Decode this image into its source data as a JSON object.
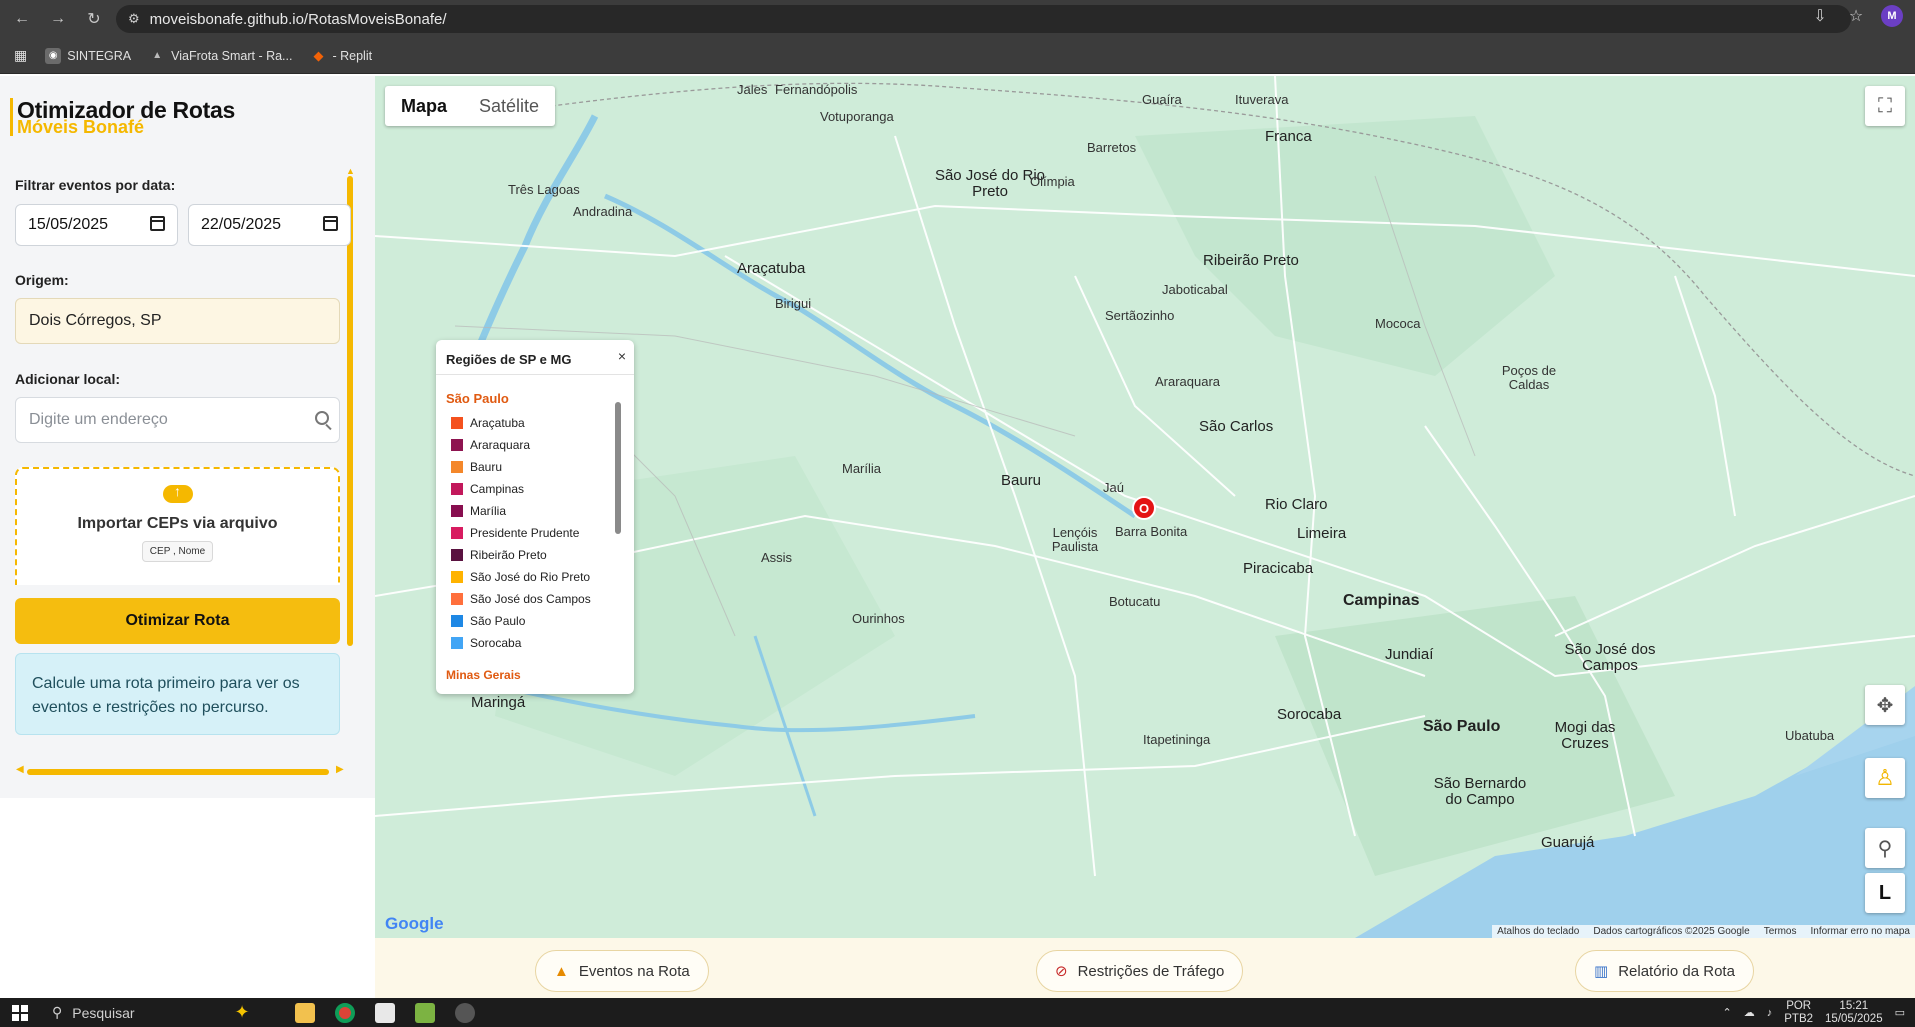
{
  "browser": {
    "url": "moveisbonafe.github.io/RotasMoveisBonafe/",
    "profile_initial": "M",
    "bookmarks": [
      {
        "label": "SINTEGRA",
        "icon": "globe-icon",
        "color": "#6b6b6b"
      },
      {
        "label": "ViaFrota Smart - Ra...",
        "icon": "car-icon",
        "color": "#555"
      },
      {
        "label": "- Replit",
        "icon": "replit-icon",
        "color": "#f26207"
      }
    ]
  },
  "sidebar": {
    "title": "Otimizador de Rotas",
    "subtitle": "Móveis Bonafé",
    "date_filter_label": "Filtrar eventos por data:",
    "date_start": "15/05/2025",
    "date_end": "22/05/2025",
    "origin_label": "Origem:",
    "origin_value": "Dois Córregos, SP",
    "add_label": "Adicionar local:",
    "add_placeholder": "Digite um endereço",
    "import_title": "Importar CEPs via arquivo",
    "import_format": "CEP , Nome",
    "optimize_button": "Otimizar Rota",
    "info_text": "Calcule uma rota primeiro para ver os eventos e restrições no percurso.",
    "accent_color": "#f5b800"
  },
  "map": {
    "type_map": "Mapa",
    "type_satellite": "Satélite",
    "marker_label": "O",
    "attribution": [
      "Atalhos do teclado",
      "Dados cartográficos ©2025 Google",
      "Termos",
      "Informar erro no mapa"
    ],
    "google": "Google",
    "pegman_label": "",
    "l_button": "L",
    "cities": [
      {
        "name": "Jales",
        "cls": ""
      },
      {
        "name": "Fernandópolis",
        "cls": ""
      },
      {
        "name": "Votuporanga",
        "cls": ""
      },
      {
        "name": "Guaíra",
        "cls": ""
      },
      {
        "name": "Ituverava",
        "cls": ""
      },
      {
        "name": "Franca",
        "cls": "mid"
      },
      {
        "name": "São José do Rio Preto",
        "cls": "mid"
      },
      {
        "name": "Olímpia",
        "cls": ""
      },
      {
        "name": "Barretos",
        "cls": ""
      },
      {
        "name": "Três Lagoas",
        "cls": ""
      },
      {
        "name": "Andradina",
        "cls": ""
      },
      {
        "name": "Araçatuba",
        "cls": "mid"
      },
      {
        "name": "Birigui",
        "cls": ""
      },
      {
        "name": "Ribeirão Preto",
        "cls": "mid"
      },
      {
        "name": "Jaboticabal",
        "cls": ""
      },
      {
        "name": "Sertãozinho",
        "cls": ""
      },
      {
        "name": "Araraquara",
        "cls": ""
      },
      {
        "name": "São Carlos",
        "cls": "mid"
      },
      {
        "name": "Bauru",
        "cls": "mid"
      },
      {
        "name": "Jaú",
        "cls": ""
      },
      {
        "name": "Barra Bonita",
        "cls": ""
      },
      {
        "name": "Lençóis Paulista",
        "cls": ""
      },
      {
        "name": "Rio Claro",
        "cls": "mid"
      },
      {
        "name": "Piracicaba",
        "cls": "mid"
      },
      {
        "name": "Limeira",
        "cls": "mid"
      },
      {
        "name": "Campinas",
        "cls": "big"
      },
      {
        "name": "Jundiaí",
        "cls": "mid"
      },
      {
        "name": "Sorocaba",
        "cls": "mid"
      },
      {
        "name": "São Paulo",
        "cls": "big"
      },
      {
        "name": "Marília",
        "cls": ""
      },
      {
        "name": "Ourinhos",
        "cls": ""
      },
      {
        "name": "Assis",
        "cls": ""
      },
      {
        "name": "Botucatu",
        "cls": ""
      },
      {
        "name": "Itapetininga",
        "cls": ""
      },
      {
        "name": "Mogi das Cruzes",
        "cls": "mid"
      },
      {
        "name": "São José dos Campos",
        "cls": "mid"
      },
      {
        "name": "Guarujá",
        "cls": "mid"
      },
      {
        "name": "São Bernardo do Campo",
        "cls": "mid"
      },
      {
        "name": "Maringá",
        "cls": "mid"
      },
      {
        "name": "Poços de Caldas",
        "cls": ""
      },
      {
        "name": "Mococa",
        "cls": ""
      },
      {
        "name": "Ubatuba",
        "cls": ""
      }
    ]
  },
  "legend": {
    "title": "Regiões de SP e MG",
    "close": "×",
    "group_sp": "São Paulo",
    "group_mg": "Minas Gerais",
    "items": [
      {
        "label": "Araçatuba",
        "color": "#f4511e"
      },
      {
        "label": "Araraquara",
        "color": "#8e1450"
      },
      {
        "label": "Bauru",
        "color": "#f4872a"
      },
      {
        "label": "Campinas",
        "color": "#c2185b"
      },
      {
        "label": "Marília",
        "color": "#880e4f"
      },
      {
        "label": "Presidente Prudente",
        "color": "#d81b60"
      },
      {
        "label": "Ribeirão Preto",
        "color": "#5a1240"
      },
      {
        "label": "São José do Rio Preto",
        "color": "#ffb300"
      },
      {
        "label": "São José dos Campos",
        "color": "#ff6f3c"
      },
      {
        "label": "São Paulo",
        "color": "#1e88e5"
      },
      {
        "label": "Sorocaba",
        "color": "#42a5f5"
      }
    ]
  },
  "bottom": {
    "events": "Eventos na Rota",
    "restrictions": "Restrições de Tráfego",
    "report": "Relatório da Rota"
  },
  "taskbar": {
    "search": "Pesquisar",
    "lang1": "POR",
    "lang2": "PTB2",
    "time": "15:21",
    "date": "15/05/2025"
  }
}
